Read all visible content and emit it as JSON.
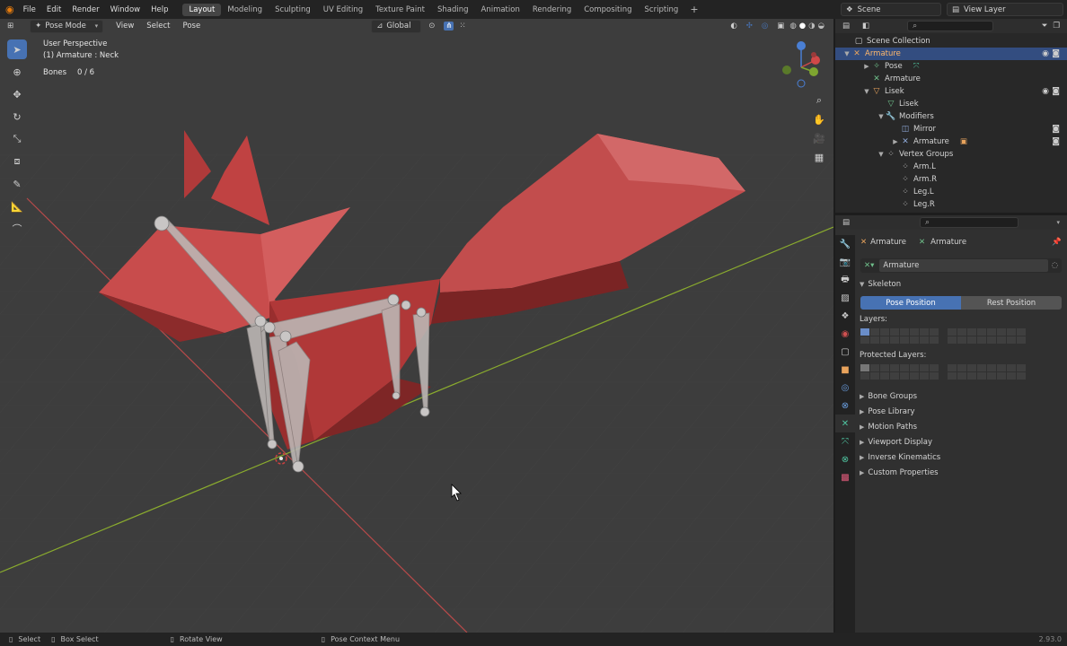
{
  "menu": {
    "file": "File",
    "edit": "Edit",
    "render": "Render",
    "window": "Window",
    "help": "Help"
  },
  "workspaces": [
    "Layout",
    "Modeling",
    "Sculpting",
    "UV Editing",
    "Texture Paint",
    "Shading",
    "Animation",
    "Rendering",
    "Compositing",
    "Scripting"
  ],
  "scene": "Scene",
  "view_layer": "View Layer",
  "viewport": {
    "mode": "Pose Mode",
    "menus": [
      "View",
      "Select",
      "Pose"
    ],
    "orientation": "Global",
    "perspective": "User Perspective",
    "active": "(1) Armature : Neck",
    "bones_label": "Bones",
    "bones_value": "0 / 6"
  },
  "outliner": {
    "root": "Scene Collection",
    "items": [
      "Armature",
      "Pose",
      "Armature",
      "Lisek",
      "Lisek",
      "Modifiers",
      "Mirror",
      "Armature",
      "Vertex Groups",
      "Arm.L",
      "Arm.R",
      "Leg.L",
      "Leg.R"
    ]
  },
  "properties": {
    "crumb1": "Armature",
    "crumb2": "Armature",
    "datablock": "Armature",
    "skeleton": "Skeleton",
    "pose_position": "Pose Position",
    "rest_position": "Rest Position",
    "layers": "Layers:",
    "protected_layers": "Protected Layers:",
    "panels": [
      "Bone Groups",
      "Pose Library",
      "Motion Paths",
      "Viewport Display",
      "Inverse Kinematics",
      "Custom Properties"
    ]
  },
  "status": {
    "select": "Select",
    "box_select": "Box Select",
    "rotate": "Rotate View",
    "context": "Pose Context Menu",
    "version": "2.93.0"
  },
  "colors": {
    "accent": "#4772b3",
    "selected": "#334d80",
    "model": "#b83c3c",
    "x_axis": "#c04848",
    "y_axis": "#8aab2e"
  }
}
